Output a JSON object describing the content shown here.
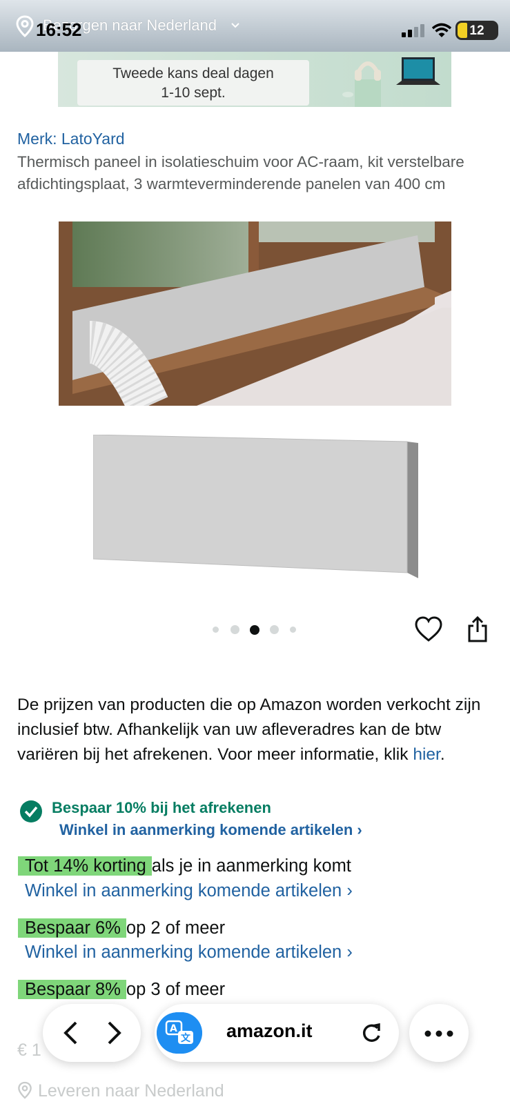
{
  "status_bar": {
    "time": "16:52",
    "battery": "12"
  },
  "delivery_bar": {
    "label": "Bezorgen naar Nederland"
  },
  "banner": {
    "line1": "Tweede kans deal dagen",
    "line2": "1-10 sept."
  },
  "product": {
    "brand": "Merk: LatoYard",
    "title": "Thermisch paneel in isolatieschuim voor AC-raam, kit verstelbare afdichtingsplaat, 3 warmteverminderende panelen van 400 cm"
  },
  "gallery": {
    "dot_count": 5,
    "active_index": 2
  },
  "vat_notice": {
    "text": "De prijzen van producten die op Amazon worden verkocht zijn inclusief btw. Afhankelijk van uw afleveradres kan de btw variëren bij het afrekenen. Voor meer informatie, klik ",
    "link": "hier",
    "end": "."
  },
  "promo": {
    "save10": "Bespaar 10% bij het afrekenen",
    "shop_label": "Winkel in aanmerking komende artikelen",
    "offers": [
      {
        "badge": "Tot 14% korting",
        "rest": "als je in aanmerking komt"
      },
      {
        "badge": "Bespaar 6%",
        "rest": "op 2 of meer"
      },
      {
        "badge": "Bespaar 8%",
        "rest": "op 3 of meer"
      }
    ]
  },
  "faded": {
    "price": "€ 1",
    "deliver": "Leveren naar Nederland"
  },
  "browser": {
    "url": "amazon.it"
  },
  "colors": {
    "link": "#2162a1",
    "green": "#067d62",
    "highlight": "#7fd67a",
    "translate": "#1e8ef2"
  }
}
